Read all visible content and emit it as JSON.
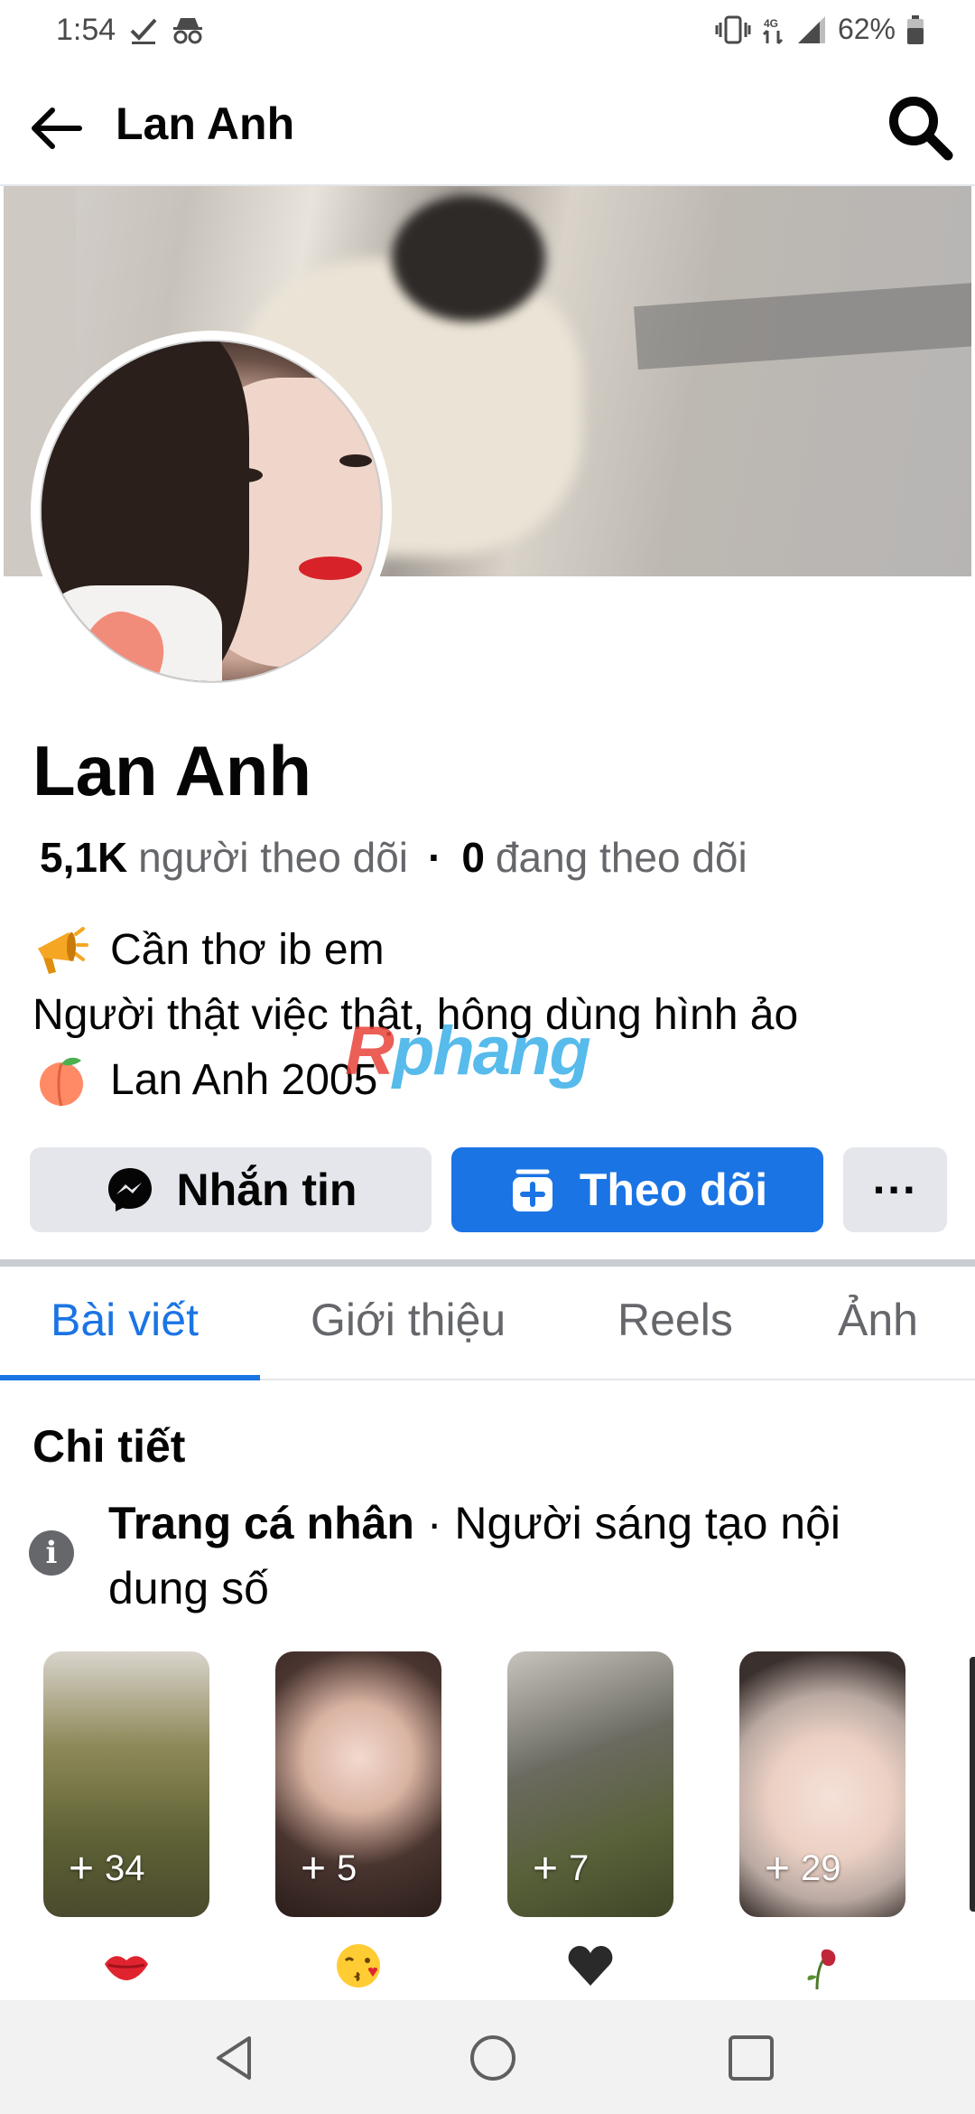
{
  "status_bar": {
    "time": "1:54",
    "battery": "62%"
  },
  "header": {
    "title": "Lan Anh"
  },
  "profile": {
    "name": "Lan Anh",
    "followers_count": "5,1K",
    "followers_label": "người theo dõi",
    "following_count": "0",
    "following_label": "đang theo dõi",
    "bio": [
      {
        "emoji": "megaphone-icon",
        "text": "Cần thơ ib em"
      },
      {
        "emoji": "",
        "text": "Người thật việc thật, hông dùng hình ảo"
      },
      {
        "emoji": "peach-icon",
        "text": "Lan Anh 2005"
      }
    ]
  },
  "watermark": {
    "text": "Rphang"
  },
  "actions": {
    "message_label": "Nhắn tin",
    "follow_label": "Theo dõi",
    "more_label": "···"
  },
  "tabs": [
    {
      "label": "Bài viết",
      "active": true
    },
    {
      "label": "Giới thiệu",
      "active": false
    },
    {
      "label": "Reels",
      "active": false
    },
    {
      "label": "Ảnh",
      "active": false
    }
  ],
  "details": {
    "title": "Chi tiết",
    "type_bold": "Trang cá nhân",
    "type_rest": " · Người sáng tạo nội dung số"
  },
  "highlights": [
    {
      "count": "34",
      "emoji": "lips-icon"
    },
    {
      "count": "5",
      "emoji": "kissing-face-icon"
    },
    {
      "count": "7",
      "emoji": "black-heart-icon"
    },
    {
      "count": "29",
      "emoji": "wilted-rose-icon"
    }
  ],
  "colors": {
    "accent": "#1b74e4",
    "button_gray": "#e4e6eb",
    "secondary_text": "#65676b"
  }
}
